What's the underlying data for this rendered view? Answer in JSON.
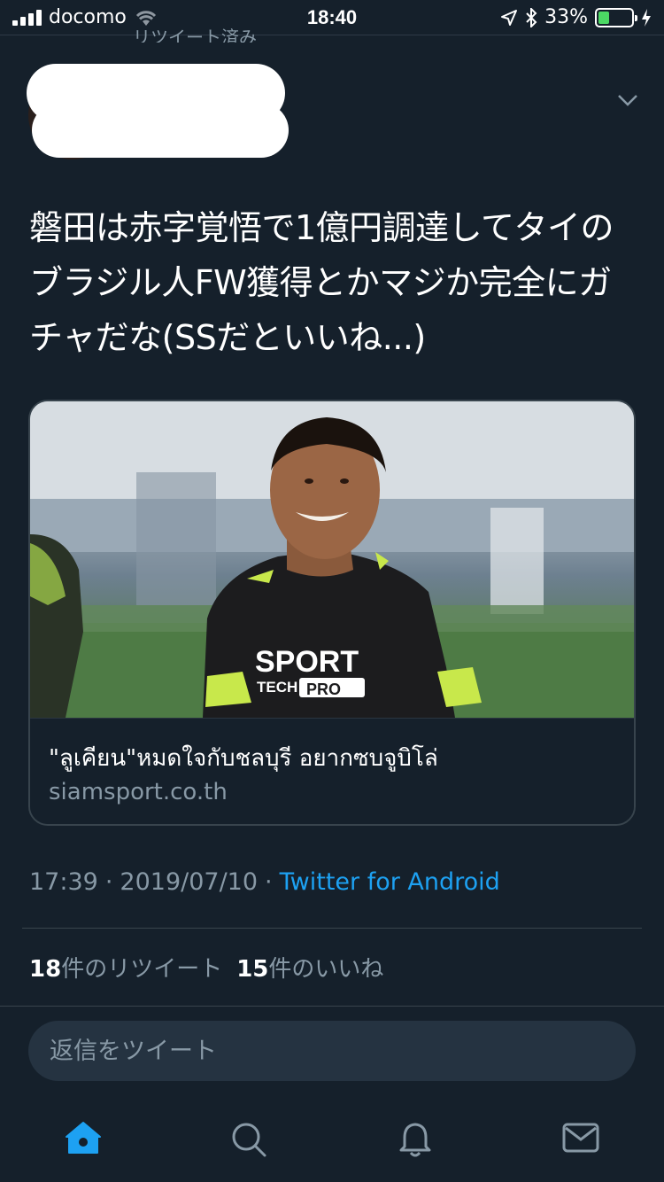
{
  "status_bar": {
    "carrier": "docomo",
    "time": "18:40",
    "battery_percent": "33%",
    "battery_level": 0.33,
    "icons": [
      "signal-icon",
      "wifi-icon",
      "location-icon",
      "bluetooth-icon",
      "battery-icon",
      "charging-icon"
    ]
  },
  "retweet_banner": "リツイート済み",
  "tweet": {
    "text": "磐田は赤字覚悟で1億円調達してタイのブラジル人FW獲得とかマジか完全にガチャだな(SSだといいね...)",
    "card": {
      "title": "\"ลูเคียน\"หมดใจกับชลบุรี อยากซบจูบิโล่",
      "domain": "siamsport.co.th"
    },
    "time": "17:39",
    "separator": "·",
    "date": "2019/07/10",
    "source": "Twitter for Android",
    "retweet_count": "18",
    "retweet_label": "件のリツイート",
    "like_count": "15",
    "like_label": "件のいいね"
  },
  "reply": {
    "placeholder": "返信をツイート"
  },
  "tabs": [
    {
      "name": "home-icon",
      "active": true
    },
    {
      "name": "search-icon",
      "active": false
    },
    {
      "name": "notifications-icon",
      "active": false
    },
    {
      "name": "messages-icon",
      "active": false
    }
  ],
  "colors": {
    "background": "#15202b",
    "accent": "#1da1f2",
    "secondary_text": "#8899a6",
    "border": "#38444d"
  }
}
